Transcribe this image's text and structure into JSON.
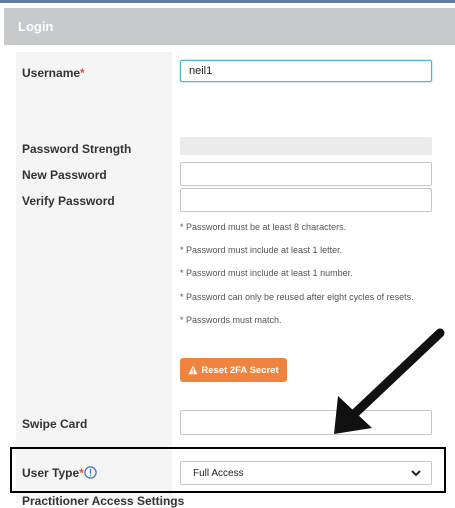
{
  "header": {
    "title": "Login"
  },
  "form": {
    "username": {
      "label": "Username",
      "required_mark": "*",
      "value": "neil1"
    },
    "password_strength": {
      "label": "Password Strength"
    },
    "new_password": {
      "label": "New Password",
      "value": ""
    },
    "verify_password": {
      "label": "Verify Password",
      "value": ""
    },
    "hints": [
      "* Password must be at least 8 characters.",
      "* Password must include at least 1 letter.",
      "* Password must include at least 1 number.",
      "* Password can only be reused after eight cycles of resets.",
      "* Passwords must match."
    ],
    "reset_2fa_label": "Reset 2FA Secret",
    "swipe_card": {
      "label": "Swipe Card",
      "value": ""
    },
    "user_type": {
      "label": "User Type",
      "required_mark": "*",
      "selected": "Full Access"
    },
    "next_section_label": "Practitioner Access Settings"
  },
  "icons": {
    "warning": "warning-icon",
    "info": "info-icon",
    "chevron": "chevron-down-icon",
    "annotation_arrow": "annotation-arrow"
  },
  "colors": {
    "header_bg": "#c7c9cb",
    "label_col_bg": "#f5f5f5",
    "required": "#d9534f",
    "reset_button": "#f0843e",
    "focus_border": "#4fb3c7",
    "info_icon": "#3a72c4"
  }
}
